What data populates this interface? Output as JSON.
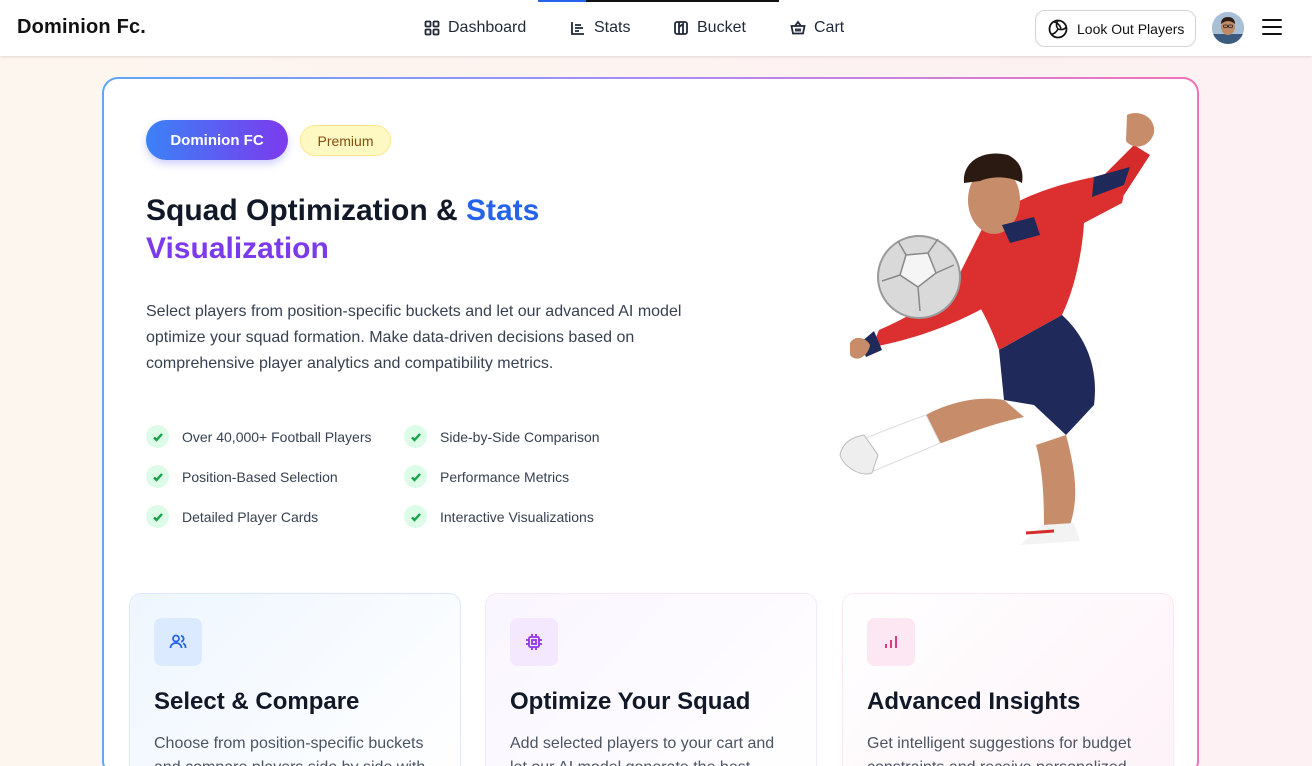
{
  "app": {
    "brand": "Dominion Fc."
  },
  "nav": [
    {
      "label": "Dashboard",
      "icon": "dashboard-icon"
    },
    {
      "label": "Stats",
      "icon": "stats-icon"
    },
    {
      "label": "Bucket",
      "icon": "bucket-icon"
    },
    {
      "label": "Cart",
      "icon": "cart-icon"
    }
  ],
  "header": {
    "lookout_label": "Look Out Players",
    "avatar": "user-avatar",
    "menu": "menu-icon"
  },
  "hero": {
    "badge": "Dominion FC",
    "tag": "Premium",
    "headline_part1": "Squad Optimization & ",
    "headline_part2": "Stats",
    "headline_part3": "Visualization",
    "description": "Select players from position-specific buckets and let our advanced AI model optimize your squad formation. Make data-driven decisions based on comprehensive player analytics and compatibility metrics.",
    "features": [
      "Over 40,000+ Football Players",
      "Side-by-Side Comparison",
      "Position-Based Selection",
      "Performance Metrics",
      "Detailed Player Cards",
      "Interactive Visualizations"
    ]
  },
  "cards": [
    {
      "title": "Select & Compare",
      "text": "Choose from position-specific buckets and compare players side by side with",
      "icon": "users-icon"
    },
    {
      "title": "Optimize Your Squad",
      "text": "Add selected players to your cart and let our AI model generate the best",
      "icon": "cpu-icon"
    },
    {
      "title": "Advanced Insights",
      "text": "Get intelligent suggestions for budget constraints and receive personalized",
      "icon": "bar-chart-icon"
    }
  ],
  "colors": {
    "accent_blue": "#2563eb",
    "accent_purple": "#7c3aed",
    "accent_pink": "#db2777",
    "check_green": "#16a34a"
  }
}
